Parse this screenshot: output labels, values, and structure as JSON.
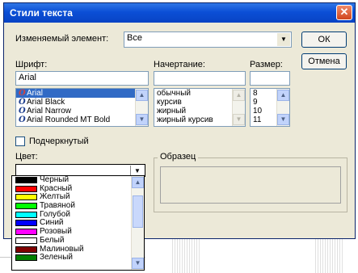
{
  "dialog": {
    "title": "Стили текста",
    "close_glyph": "✕"
  },
  "element": {
    "label": "Изменяемый элемент:",
    "value": "Все"
  },
  "buttons": {
    "ok": "ОК",
    "cancel": "Отмена"
  },
  "font": {
    "label": "Шрифт:",
    "value": "Arial",
    "items": [
      {
        "name": "Arial",
        "selected": true
      },
      {
        "name": "Arial Black"
      },
      {
        "name": "Arial Narrow"
      },
      {
        "name": "Arial Rounded MT Bold"
      }
    ],
    "icon": "opentype-icon"
  },
  "style": {
    "label": "Начертание:",
    "value": "",
    "items": [
      "обычный",
      "курсив",
      "жирный",
      "жирный курсив"
    ]
  },
  "size": {
    "label": "Размер:",
    "value": "",
    "items": [
      "8",
      "9",
      "10",
      "11"
    ]
  },
  "underline": {
    "label": "Подчеркнутый",
    "checked": false
  },
  "color": {
    "label": "Цвет:",
    "value": "",
    "options": [
      {
        "name": "Черный",
        "hex": "#000000"
      },
      {
        "name": "Красный",
        "hex": "#ff0000"
      },
      {
        "name": "Желтый",
        "hex": "#ffff00"
      },
      {
        "name": "Травяной",
        "hex": "#00ff00"
      },
      {
        "name": "Голубой",
        "hex": "#00ffff"
      },
      {
        "name": "Синий",
        "hex": "#0000ff"
      },
      {
        "name": "Розовый",
        "hex": "#ff00ff"
      },
      {
        "name": "Белый",
        "hex": "#ffffff"
      },
      {
        "name": "Малиновый",
        "hex": "#800000"
      },
      {
        "name": "Зеленый",
        "hex": "#008000"
      }
    ]
  },
  "preview": {
    "label": "Образец"
  },
  "icons": {
    "scroll_up": "▲",
    "scroll_down": "▼",
    "dropdown": "▼"
  }
}
